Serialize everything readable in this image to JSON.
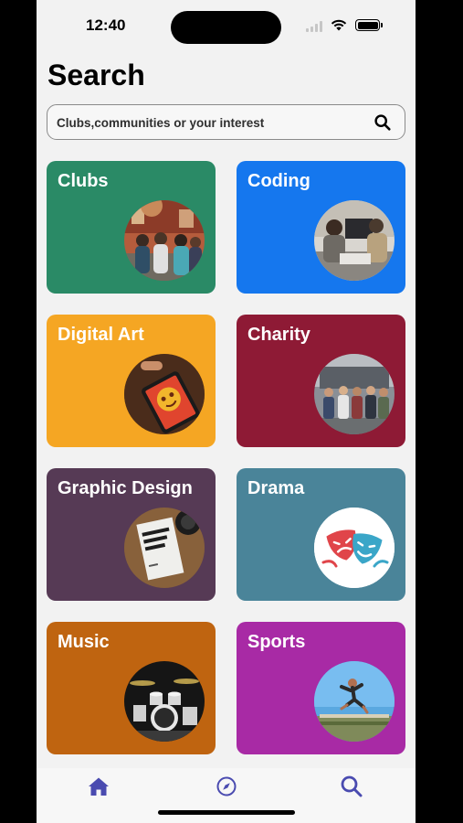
{
  "status_bar": {
    "time": "12:40"
  },
  "page": {
    "title": "Search"
  },
  "search": {
    "placeholder": "Clubs,communities or your interest"
  },
  "categories": [
    {
      "label": "Clubs",
      "color": "#2a8a66",
      "icon": "students-photo"
    },
    {
      "label": "Coding",
      "color": "#1577ee",
      "icon": "coders-photo"
    },
    {
      "label": "Digital Art",
      "color": "#f5a623",
      "icon": "tablet-drawing-photo"
    },
    {
      "label": "Charity",
      "color": "#8e1a35",
      "icon": "volunteers-photo"
    },
    {
      "label": "Graphic Design",
      "color": "#563a55",
      "icon": "design-book-photo"
    },
    {
      "label": "Drama",
      "color": "#4a8499",
      "icon": "theatre-masks-icon"
    },
    {
      "label": "Music",
      "color": "#bf6410",
      "icon": "drum-kit-photo"
    },
    {
      "label": "Sports",
      "color": "#a82aa5",
      "icon": "athlete-jump-photo"
    }
  ],
  "tab_bar": {
    "active_tab": "search",
    "tabs": [
      {
        "id": "home",
        "icon": "home-icon"
      },
      {
        "id": "explore",
        "icon": "compass-icon"
      },
      {
        "id": "search",
        "icon": "search-icon"
      }
    ],
    "accent_color": "#4a4bb0"
  }
}
